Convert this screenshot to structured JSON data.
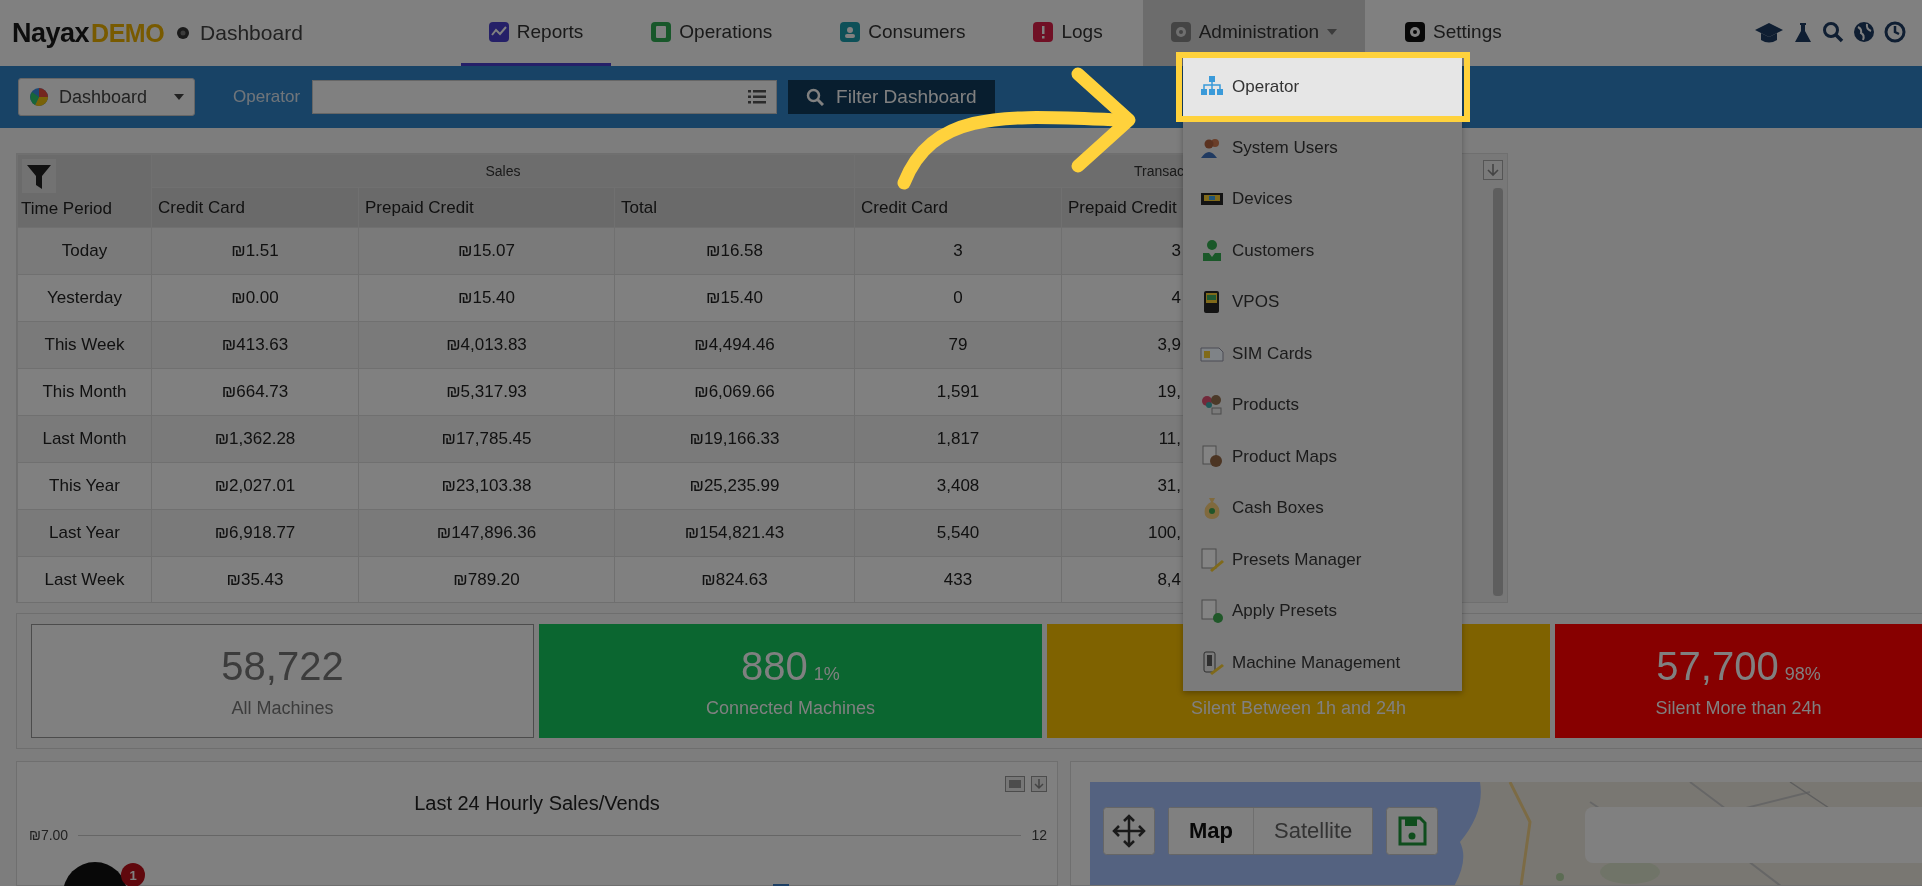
{
  "nav": {
    "logo": {
      "brand": "Nayax",
      "edition": "DEMO"
    },
    "page": "Dashboard",
    "tabs": [
      {
        "label": "Reports",
        "selected": true,
        "expanded": false,
        "dropdown": false
      },
      {
        "label": "Operations",
        "selected": false,
        "expanded": false,
        "dropdown": false
      },
      {
        "label": "Consumers",
        "selected": false,
        "expanded": false,
        "dropdown": false
      },
      {
        "label": "Logs",
        "selected": false,
        "expanded": false,
        "dropdown": false
      },
      {
        "label": "Administration",
        "selected": false,
        "expanded": true,
        "dropdown": true
      },
      {
        "label": "Settings",
        "selected": false,
        "expanded": false,
        "dropdown": false
      }
    ]
  },
  "toolbar": {
    "view": "Dashboard",
    "operator_label": "Operator",
    "filter_button": "Filter Dashboard"
  },
  "table": {
    "first_column": "Time Period",
    "groups": [
      {
        "label": "Sales",
        "columns": [
          "Credit Card",
          "Prepaid Credit",
          "Total"
        ]
      },
      {
        "label": "Transac",
        "columns": [
          "Credit Card",
          "Prepaid Credit"
        ]
      }
    ],
    "rows": [
      {
        "period": "Today",
        "cells": [
          "₪1.51",
          "₪15.07",
          "₪16.58",
          "3",
          "3"
        ]
      },
      {
        "period": "Yesterday",
        "cells": [
          "₪0.00",
          "₪15.40",
          "₪15.40",
          "0",
          "4"
        ]
      },
      {
        "period": "This Week",
        "cells": [
          "₪413.63",
          "₪4,013.83",
          "₪4,494.46",
          "79",
          "3,9"
        ]
      },
      {
        "period": "This Month",
        "cells": [
          "₪664.73",
          "₪5,317.93",
          "₪6,069.66",
          "1,591",
          "19,"
        ]
      },
      {
        "period": "Last Month",
        "cells": [
          "₪1,362.28",
          "₪17,785.45",
          "₪19,166.33",
          "1,817",
          "11,"
        ]
      },
      {
        "period": "This Year",
        "cells": [
          "₪2,027.01",
          "₪23,103.38",
          "₪25,235.99",
          "3,408",
          "31,"
        ]
      },
      {
        "period": "Last Year",
        "cells": [
          "₪6,918.77",
          "₪147,896.36",
          "₪154,821.43",
          "5,540",
          "100,"
        ]
      },
      {
        "period": "Last Week",
        "cells": [
          "₪35.43",
          "₪789.20",
          "₪824.63",
          "433",
          "8,4"
        ]
      }
    ]
  },
  "kpis": [
    {
      "kind": "outline",
      "value": "58,722",
      "label": "All Machines"
    },
    {
      "kind": "filled",
      "color": "#0b6630",
      "value": "880",
      "percent": "1%",
      "label": "Connected Machines"
    },
    {
      "kind": "filled",
      "color": "#7f6200",
      "label": "Silent Between 1h and 24h"
    },
    {
      "kind": "filled",
      "color": "#870000",
      "value": "57,700",
      "percent": "98%",
      "label": "Silent More than 24h"
    }
  ],
  "chart": {
    "title": "Last 24 Hourly Sales/Vends",
    "left_tick": "₪7.00",
    "right_tick": "12"
  },
  "notification": {
    "count": "1"
  },
  "map": {
    "modes": [
      {
        "label": "Map",
        "selected": true
      },
      {
        "label": "Satellite",
        "selected": false
      }
    ]
  },
  "menu": {
    "items": [
      {
        "label": "Operator",
        "selected": true
      },
      {
        "label": "System Users",
        "selected": false
      },
      {
        "label": "Devices",
        "selected": false
      },
      {
        "label": "Customers",
        "selected": false
      },
      {
        "label": "VPOS",
        "selected": false
      },
      {
        "label": "SIM Cards",
        "selected": false
      },
      {
        "label": "Products",
        "selected": false
      },
      {
        "label": "Product Maps",
        "selected": false
      },
      {
        "label": "Cash Boxes",
        "selected": false
      },
      {
        "label": "Presets Manager",
        "selected": false
      },
      {
        "label": "Apply Presets",
        "selected": false
      },
      {
        "label": "Machine Management",
        "selected": false
      }
    ]
  }
}
